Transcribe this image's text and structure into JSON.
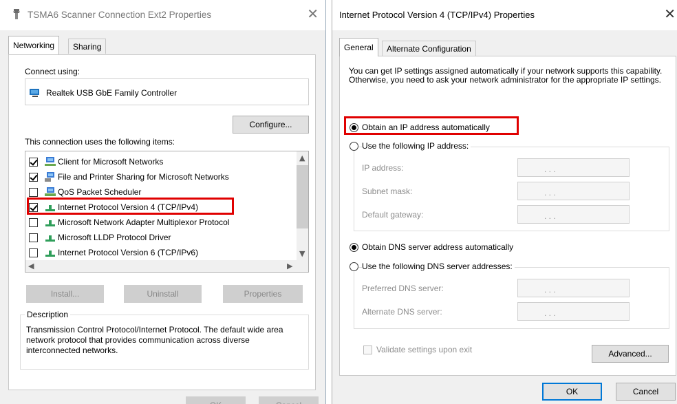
{
  "left_window": {
    "title": "TSMA6 Scanner Connection Ext2 Properties",
    "tabs": [
      {
        "label": "Networking",
        "active": true
      },
      {
        "label": "Sharing",
        "active": false
      }
    ],
    "connect_using_label": "Connect using:",
    "adapter_name": "Realtek USB GbE Family Controller",
    "configure_button": "Configure...",
    "items_label": "This connection uses the following items:",
    "items": [
      {
        "label": "Client for Microsoft Networks",
        "checked": true,
        "icon": "network-client-icon"
      },
      {
        "label": "File and Printer Sharing for Microsoft Networks",
        "checked": true,
        "icon": "file-printer-sharing-icon"
      },
      {
        "label": "QoS Packet Scheduler",
        "checked": false,
        "icon": "qos-scheduler-icon"
      },
      {
        "label": "Internet Protocol Version 4 (TCP/IPv4)",
        "checked": true,
        "icon": "protocol-icon"
      },
      {
        "label": "Microsoft Network Adapter Multiplexor Protocol",
        "checked": false,
        "icon": "protocol-icon"
      },
      {
        "label": "Microsoft LLDP Protocol Driver",
        "checked": false,
        "icon": "protocol-icon"
      },
      {
        "label": "Internet Protocol Version 6 (TCP/IPv6)",
        "checked": false,
        "icon": "protocol-icon"
      }
    ],
    "install_button": "Install...",
    "uninstall_button": "Uninstall",
    "properties_button": "Properties",
    "description_legend": "Description",
    "description_text": "Transmission Control Protocol/Internet Protocol. The default wide area network protocol that provides communication across diverse interconnected networks.",
    "ok_button": "OK",
    "cancel_button": "Cancel"
  },
  "right_window": {
    "title": "Internet Protocol Version 4 (TCP/IPv4) Properties",
    "tabs": [
      {
        "label": "General",
        "active": true
      },
      {
        "label": "Alternate Configuration",
        "active": false
      }
    ],
    "intro_text": "You can get IP settings assigned automatically if your network supports this capability. Otherwise, you need to ask your network administrator for the appropriate IP settings.",
    "obtain_ip_auto": "Obtain an IP address automatically",
    "use_following_ip": "Use the following IP address:",
    "ip_address_label": "IP address:",
    "subnet_mask_label": "Subnet mask:",
    "default_gateway_label": "Default gateway:",
    "obtain_dns_auto": "Obtain DNS server address automatically",
    "use_following_dns": "Use the following DNS server addresses:",
    "preferred_dns_label": "Preferred DNS server:",
    "alternate_dns_label": "Alternate DNS server:",
    "ip_dots": ".     .     .",
    "validate_label": "Validate settings upon exit",
    "advanced_button": "Advanced...",
    "ok_button": "OK",
    "cancel_button": "Cancel"
  },
  "colors": {
    "highlight_red": "#e00000",
    "primary_border": "#0078d7"
  }
}
